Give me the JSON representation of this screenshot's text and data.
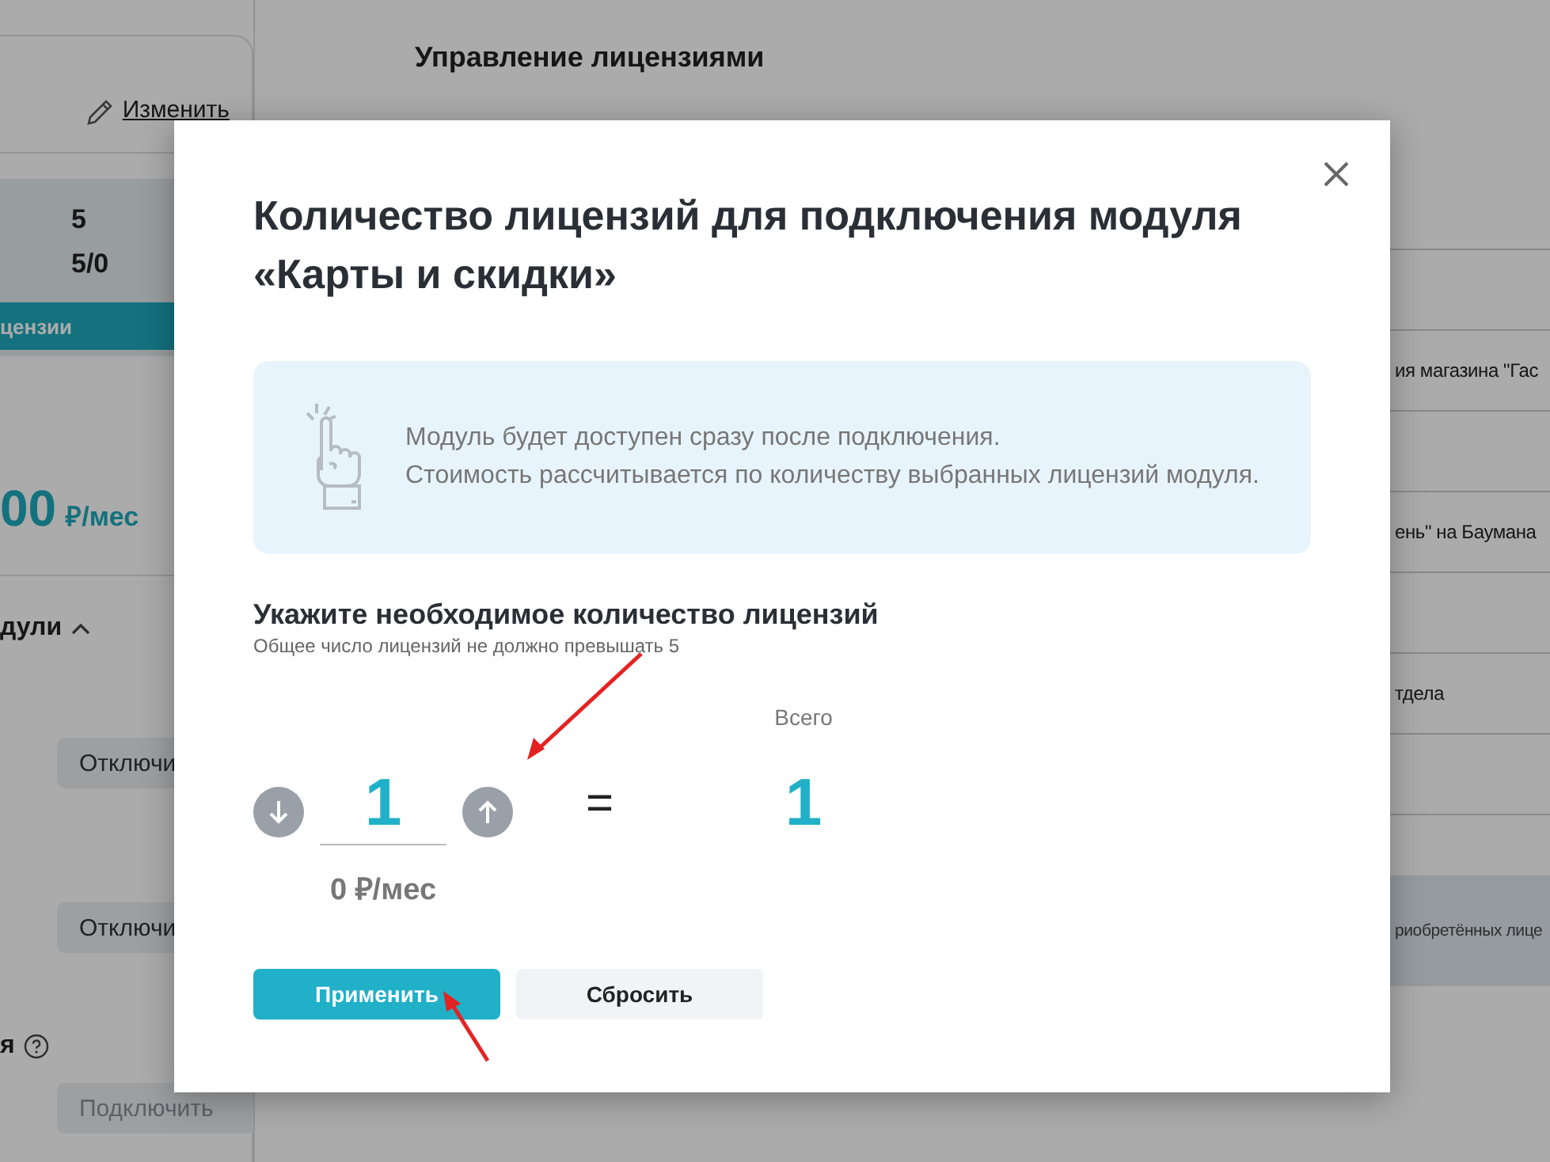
{
  "sidebar": {
    "edit_link": "Изменить",
    "stats": [
      "5",
      "5/0"
    ],
    "licenses_button": "цензии",
    "price": "00",
    "price_unit": "₽/мес",
    "modules_header": {
      "label": "дули",
      "expanded": true
    },
    "module_buttons": [
      {
        "label": "Отключи",
        "disabled": false
      },
      {
        "label": "Отключи",
        "disabled": false
      }
    ],
    "section_label": "я",
    "connect_button": {
      "label": "Подключить",
      "disabled": true
    }
  },
  "main": {
    "title": "Управление лицензиями",
    "rows": [
      "ия магазина \"Гас",
      "ень\" на Баумана",
      "тдела"
    ],
    "note": "риобретённых лице"
  },
  "modal": {
    "title": "Количество лицензий для подключения модуля «Карты и скидки»",
    "info": [
      "Модуль будет доступен сразу после подключения.",
      "Стоимость рассчитывается по количеству выбранных лицензий модуля."
    ],
    "heading": "Укажите необходимое количество лицензий",
    "hint": "Общее число лицензий не должно превышать 5",
    "quantity": "1",
    "price": "0 ₽/мес",
    "equals": "=",
    "total_label": "Всего",
    "total": "1",
    "apply": "Применить",
    "reset": "Сбросить"
  }
}
